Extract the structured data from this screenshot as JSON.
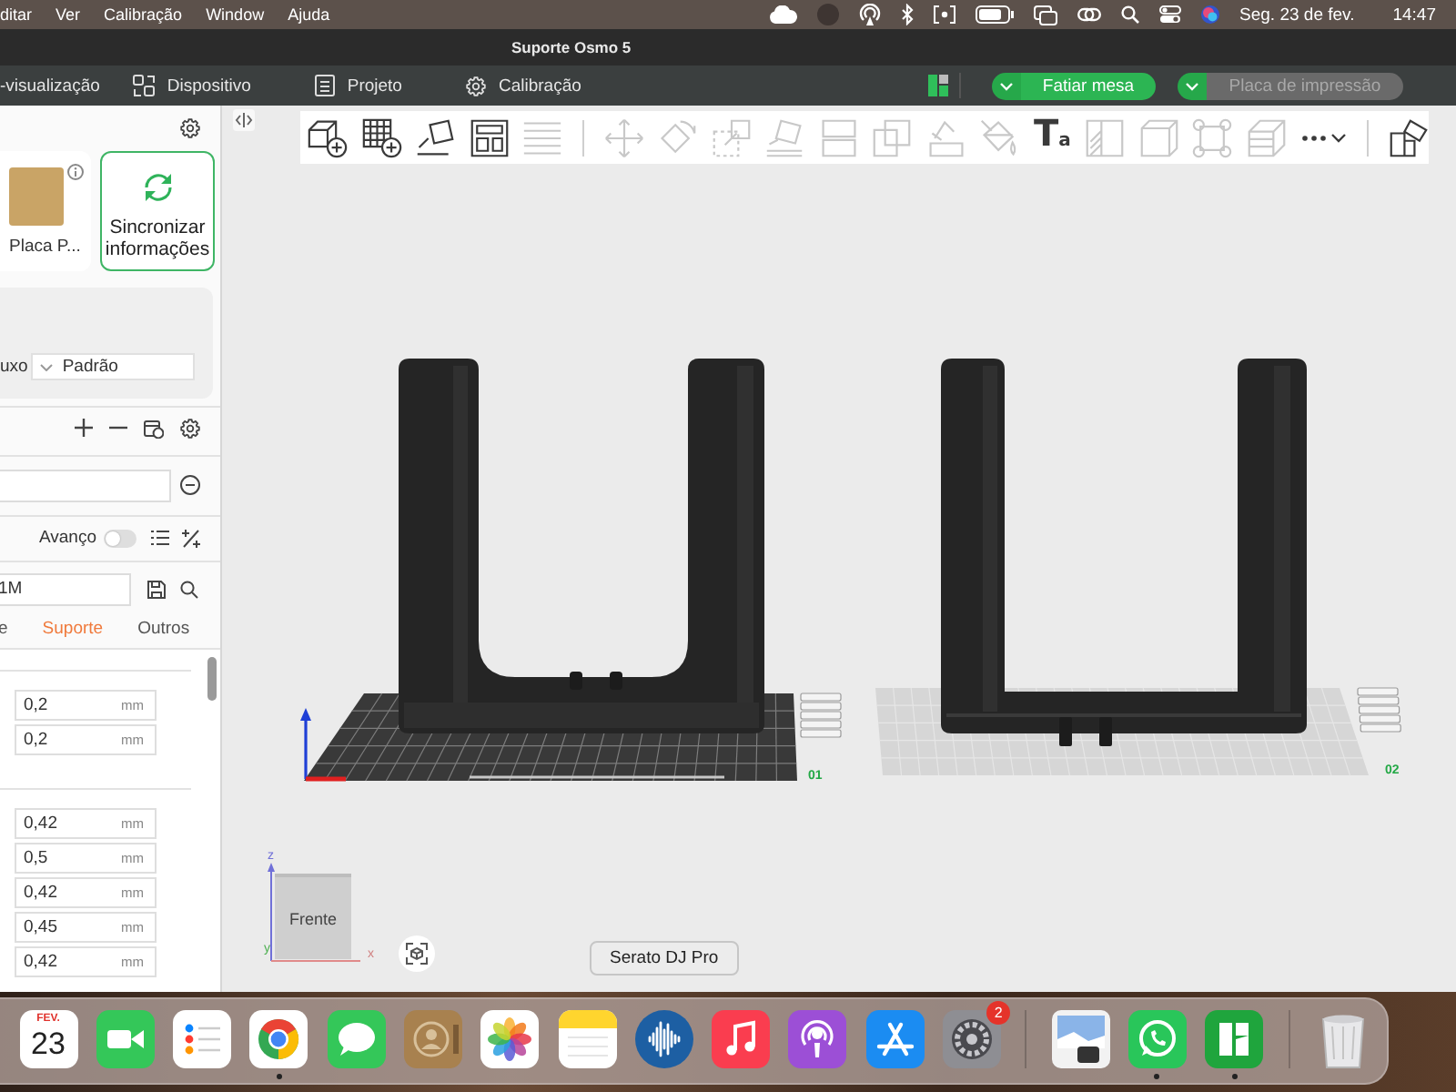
{
  "menu_bar": {
    "menus": [
      "ditar",
      "Ver",
      "Calibração",
      "Window",
      "Ajuda"
    ],
    "date": "Seg. 23 de fev.",
    "time": "14:47"
  },
  "window": {
    "title": "Suporte Osmo 5"
  },
  "app_tabs": [
    {
      "label": "-visualização",
      "selected": false
    },
    {
      "label": "Dispositivo",
      "selected": false
    },
    {
      "label": "Projeto",
      "selected": false
    },
    {
      "label": "Calibração",
      "selected": false
    }
  ],
  "actions": {
    "slice": {
      "label": "Fatiar mesa",
      "disabled": false
    },
    "print": {
      "label": "Placa de impressão",
      "disabled": true
    }
  },
  "sidebar": {
    "plate": {
      "label": "Placa P..."
    },
    "sync": {
      "label": "Sincronizar informações"
    },
    "filament": {
      "label": "uxo",
      "value": "Padrão"
    },
    "advanced": {
      "label": "Avanço",
      "on": false
    },
    "preset": {
      "value": "1M"
    },
    "tabs": [
      {
        "label": "e",
        "selected": false
      },
      {
        "label": "Suporte",
        "selected": true
      },
      {
        "label": "Outros",
        "selected": false
      }
    ],
    "groups": [
      {
        "fields": [
          {
            "value": "0,2",
            "unit": "mm"
          },
          {
            "value": "0,2",
            "unit": "mm"
          }
        ]
      },
      {
        "fields": [
          {
            "value": "0,42",
            "unit": "mm"
          },
          {
            "value": "0,5",
            "unit": "mm"
          },
          {
            "value": "0,42",
            "unit": "mm"
          },
          {
            "value": "0,45",
            "unit": "mm"
          },
          {
            "value": "0,42",
            "unit": "mm"
          }
        ]
      }
    ]
  },
  "viewport": {
    "toolbar": [
      {
        "disabled": false
      },
      {
        "disabled": false
      },
      {
        "disabled": false
      },
      {
        "disabled": false
      },
      {
        "disabled": true
      },
      {
        "disabled": true
      },
      {
        "disabled": true
      },
      {
        "disabled": true
      },
      {
        "disabled": true
      },
      {
        "disabled": true
      },
      {
        "disabled": true
      },
      {
        "disabled": true
      },
      {
        "disabled": true
      },
      {
        "label": "Ta",
        "disabled": false
      },
      {
        "disabled": true
      },
      {
        "disabled": true
      },
      {
        "disabled": true
      },
      {
        "disabled": true
      },
      {
        "disabled": false
      },
      {
        "disabled": false
      }
    ],
    "plates": [
      {
        "number": "01"
      },
      {
        "number": "02"
      }
    ],
    "view_cube": {
      "label": "Frente"
    },
    "axis_labels": [
      "z",
      "x",
      "y"
    ]
  },
  "tooltip": {
    "label": "Serato DJ Pro"
  },
  "dock": {
    "items": [
      {
        "month": "FEV.",
        "day": "23",
        "running": false
      },
      {
        "running": false
      },
      {
        "running": false
      },
      {
        "running": true
      },
      {
        "running": false
      },
      {
        "running": false
      },
      {
        "running": false
      },
      {
        "running": false
      },
      {
        "running": false
      },
      {
        "running": false
      },
      {
        "running": false
      },
      {
        "running": false
      },
      {
        "badge": "2",
        "running": false
      },
      {
        "running": false
      },
      {
        "running": true
      },
      {
        "running": true
      },
      {
        "running": false
      }
    ]
  }
}
